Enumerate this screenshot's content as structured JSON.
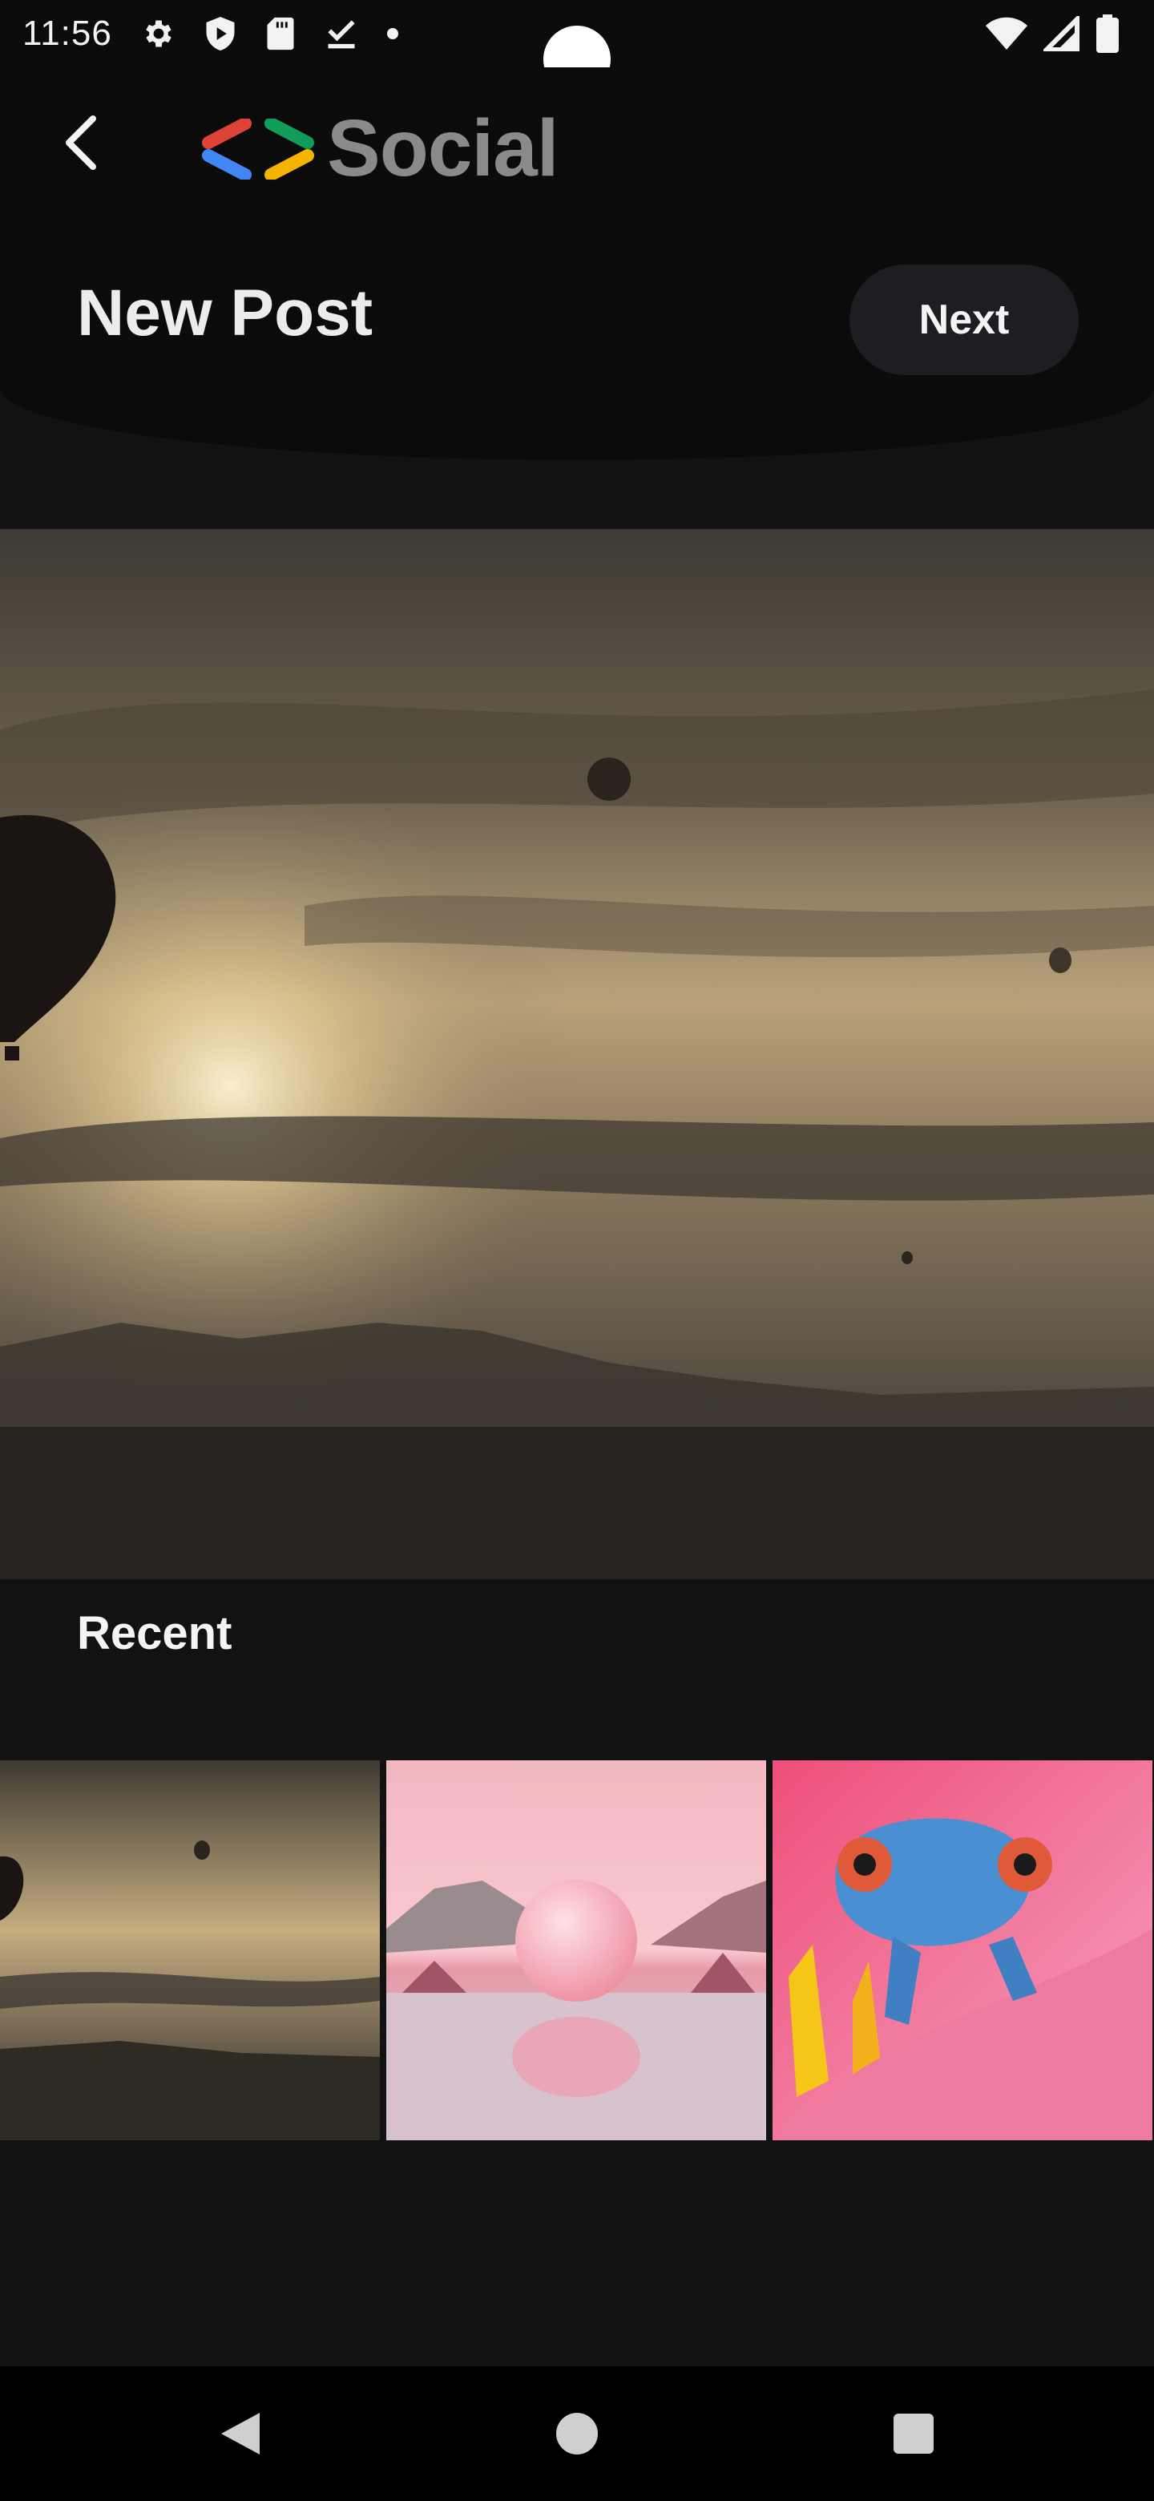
{
  "status_bar": {
    "time": "11:56",
    "left_icons": [
      "settings-icon",
      "shield-play-icon",
      "sd-card-icon",
      "download-done-icon",
      "dot-icon"
    ],
    "right_icons": [
      "wifi-icon",
      "signal-icon",
      "battery-icon"
    ]
  },
  "header": {
    "logo_text": "Social",
    "page_title": "New Post",
    "next_label": "Next",
    "back_icon": "chevron-left-icon"
  },
  "main_image": {
    "description_icon": "photo-balloons-sunset"
  },
  "recent": {
    "title": "Recent",
    "thumbnails": [
      "balloons-sunset-thumbnail",
      "pink-sphere-thumbnail",
      "chameleon-thumbnail"
    ]
  },
  "nav_bar": {
    "icons": [
      "nav-back-icon",
      "nav-home-icon",
      "nav-recents-icon"
    ]
  },
  "colors": {
    "background": "#121212",
    "header": "#0b0b0b",
    "next_button": "#1f1d22",
    "logo_text": "#8a8a8a"
  }
}
